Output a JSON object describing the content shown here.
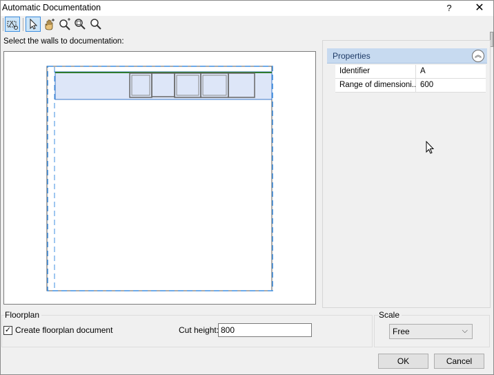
{
  "window": {
    "title": "Automatic Documentation",
    "help": "?",
    "close": "✕"
  },
  "toolbar": {
    "tools": [
      {
        "icon": "select-walls-icon",
        "active": true
      },
      {
        "icon": "arrow-pointer-icon",
        "active": true
      },
      {
        "icon": "pan-hand-icon",
        "active": false
      },
      {
        "icon": "zoom-in-icon",
        "active": false
      },
      {
        "icon": "zoom-out-icon",
        "active": false
      },
      {
        "icon": "zoom-extents-icon",
        "active": false
      }
    ]
  },
  "canvas": {
    "hint": "Select the walls to documentation:"
  },
  "properties": {
    "header": "Properties",
    "rows": [
      {
        "key": "Identifier",
        "value": "A"
      },
      {
        "key": "Range of dimensioni...",
        "value": "600"
      }
    ]
  },
  "floorplan": {
    "group_label": "Floorplan",
    "create_label": "Create floorplan document",
    "create_checked": "✓",
    "cut_height_label": "Cut height:",
    "cut_height_value": "800"
  },
  "scale": {
    "group_label": "Scale",
    "selected": "Free",
    "arrow": "⌵"
  },
  "buttons": {
    "ok": "OK",
    "cancel": "Cancel"
  },
  "colors": {
    "accent": "#3d8ee0",
    "selection_fill": "#dde6f8",
    "wall_line": "#2d7a2d",
    "header_fill": "#c7daf0"
  }
}
